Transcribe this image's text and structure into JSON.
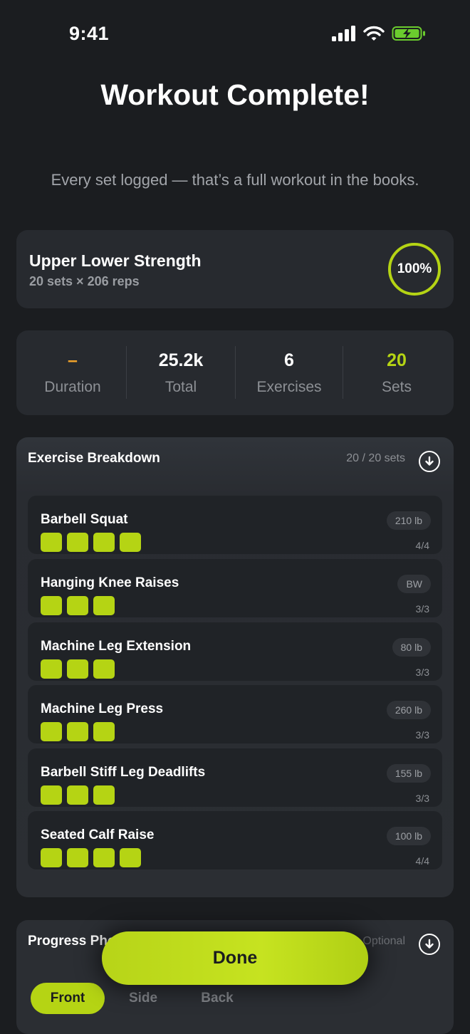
{
  "status_bar": {
    "time": "9:41"
  },
  "header": {
    "title": "Workout Complete!",
    "subtitle": "Every set logged — that’s a full workout in the books."
  },
  "summary": {
    "workout_name": "Upper Lower Strength",
    "meta": "20 sets × 206 reps",
    "completion": "100%",
    "completion_fraction": 1.0
  },
  "stats": [
    {
      "value": "–",
      "label": "Duration",
      "color": "#f0a22b"
    },
    {
      "value": "25.2k",
      "label": "Total",
      "color": "#ffffff"
    },
    {
      "value": "6",
      "label": "Exercises",
      "color": "#ffffff"
    },
    {
      "value": "20",
      "label": "Sets",
      "color": "#b5d414"
    }
  ],
  "breakdown": {
    "title": "Exercise Breakdown",
    "count": "20 / 20 sets",
    "exercises": [
      {
        "name": "Barbell Squat",
        "weight": "210 lb",
        "progress": "4/4",
        "completed_sets": 4
      },
      {
        "name": "Hanging Knee Raises",
        "weight": "BW",
        "progress": "3/3",
        "completed_sets": 3
      },
      {
        "name": "Machine Leg Extension",
        "weight": "80 lb",
        "progress": "3/3",
        "completed_sets": 3
      },
      {
        "name": "Machine Leg Press",
        "weight": "260 lb",
        "progress": "3/3",
        "completed_sets": 3
      },
      {
        "name": "Barbell Stiff Leg Deadlifts",
        "weight": "155 lb",
        "progress": "3/3",
        "completed_sets": 3
      },
      {
        "name": "Seated Calf Raise",
        "weight": "100 lb",
        "progress": "4/4",
        "completed_sets": 4
      }
    ]
  },
  "photos": {
    "title": "Progress Photos",
    "optional_label": "Optional",
    "tabs": [
      {
        "label": "Front",
        "active": true
      },
      {
        "label": "Side",
        "active": false
      },
      {
        "label": "Back",
        "active": false
      }
    ]
  },
  "done_label": "Done",
  "colors": {
    "accent": "#b5d414",
    "duration_accent": "#f0a22b",
    "background": "#1b1d20",
    "card": "#272a2f"
  }
}
